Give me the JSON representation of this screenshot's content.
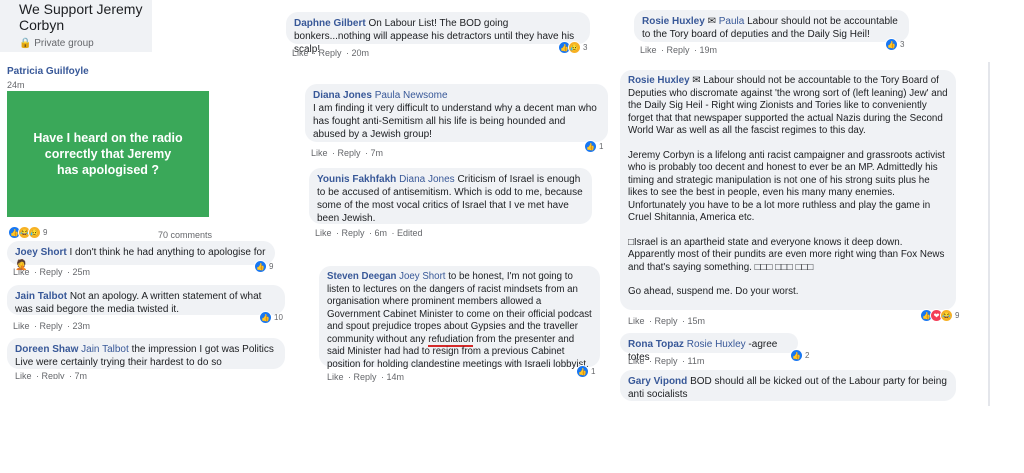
{
  "group": {
    "title": "We Support Jeremy Corbyn",
    "privacy": "Private group"
  },
  "post": {
    "author": "Patricia Guilfoyle",
    "time": "24m",
    "text": "Have I heard on the radio correctly that Jeremy has apologised ?",
    "reaction_count": "9",
    "comments_count": "70 comments",
    "bg_color": "#3aa859"
  },
  "col1": [
    {
      "name": "Joey Short",
      "text": "I don't think he had anything to apologise for",
      "like": "Like",
      "reply": "Reply",
      "time": "25m",
      "reactions": "9"
    },
    {
      "name": "Jain Talbot",
      "text": "Not an apology. A written statement of what was said begore the media twisted it.",
      "like": "Like",
      "reply": "Reply",
      "time": "23m",
      "reactions": "10"
    },
    {
      "name": "Doreen Shaw",
      "tag": "Jain Talbot",
      "text": "the impression I got was Politics Live were certainly trying their hardest to do so",
      "like": "Like",
      "reply": "Reply",
      "time": "7m"
    }
  ],
  "col2": [
    {
      "name": "Daphne Gilbert",
      "text": "On Labour List! The BOD going bonkers...nothing will appease his detractors until they have his scalp!",
      "like": "Like",
      "reply": "Reply",
      "time": "20m",
      "reactions": "3"
    },
    {
      "name": "Diana Jones",
      "tag": "Paula Newsome",
      "text": "I am finding it very difficult to understand why a decent man who has fought anti-Semitism all his life is being hounded and abused by a Jewish group!",
      "like": "Like",
      "reply": "Reply",
      "time": "7m",
      "reactions": "1"
    },
    {
      "name": "Younis Fakhfakh",
      "tag": "Diana Jones",
      "text": "Criticism of Israel is enough to be accused of antisemitism. Which is odd to me, because some of the most vocal critics of Israel that I ve met have been Jewish.",
      "like": "Like",
      "reply": "Reply",
      "time": "6m",
      "edited": "Edited"
    },
    {
      "name": "Steven Deegan",
      "tag": "Joey Short",
      "text_a": "to be honest, I'm not going to listen to lectures on the dangers of racist mindsets from an organisation where prominent members allowed a Government Cabinet Minister to come on their official podcast and spout prejudice tropes about Gypsies and the traveller community without any ",
      "underlined": "refudiation",
      "text_b": " from the presenter and said Minister had had to resign from a previous Cabinet position for holding clandestine meetings with Israeli lobbyist.",
      "like": "Like",
      "reply": "Reply",
      "time": "14m",
      "reactions": "1"
    }
  ],
  "col3": [
    {
      "name": "Rosie Huxley",
      "tag": "Paula",
      "text": "Labour should not be accountable to the Tory board of deputies and the Daily Sig Heil!",
      "like": "Like",
      "reply": "Reply",
      "time": "19m",
      "reactions": "3"
    },
    {
      "name": "Rosie Huxley",
      "p1": "Labour should not be accountable to the Tory Board of Deputies who discromate against 'the wrong sort of (left leaning) Jew' and the Daily Sig Heil - Right wing Zionists and Tories like to conveniently forget that that newspaper supported the actual Nazis during the Second World War as well as all the fascist regimes to this day.",
      "p2": "Jeremy Corbyn is a lifelong anti racist campaigner and grassroots activist who is probably too decent and honest to ever be an MP. Admittedly his timing and strategic manipulation is not one of his strong suits plus he likes to see the best in people, even his many many enemies. Unfortunately you have to be a lot more ruthless and play the game in Cruel Shitannia, America etc.",
      "p3": "Israel is an apartheid state and everyone knows it deep down. Apparently most of their pundits are even more right wing than Fox News and that's saying something.",
      "p4": "Go ahead, suspend me. Do your worst.",
      "like": "Like",
      "reply": "Reply",
      "time": "15m",
      "reactions": "9"
    },
    {
      "name": "Rona Topaz",
      "tag": "Rosie Huxley",
      "text": "-agree totes",
      "like": "Like",
      "reply": "Reply",
      "time": "11m",
      "reactions": "2"
    },
    {
      "name": "Gary Vipond",
      "text": "BOD should all be kicked out of the Labour party for being anti socialists"
    }
  ]
}
